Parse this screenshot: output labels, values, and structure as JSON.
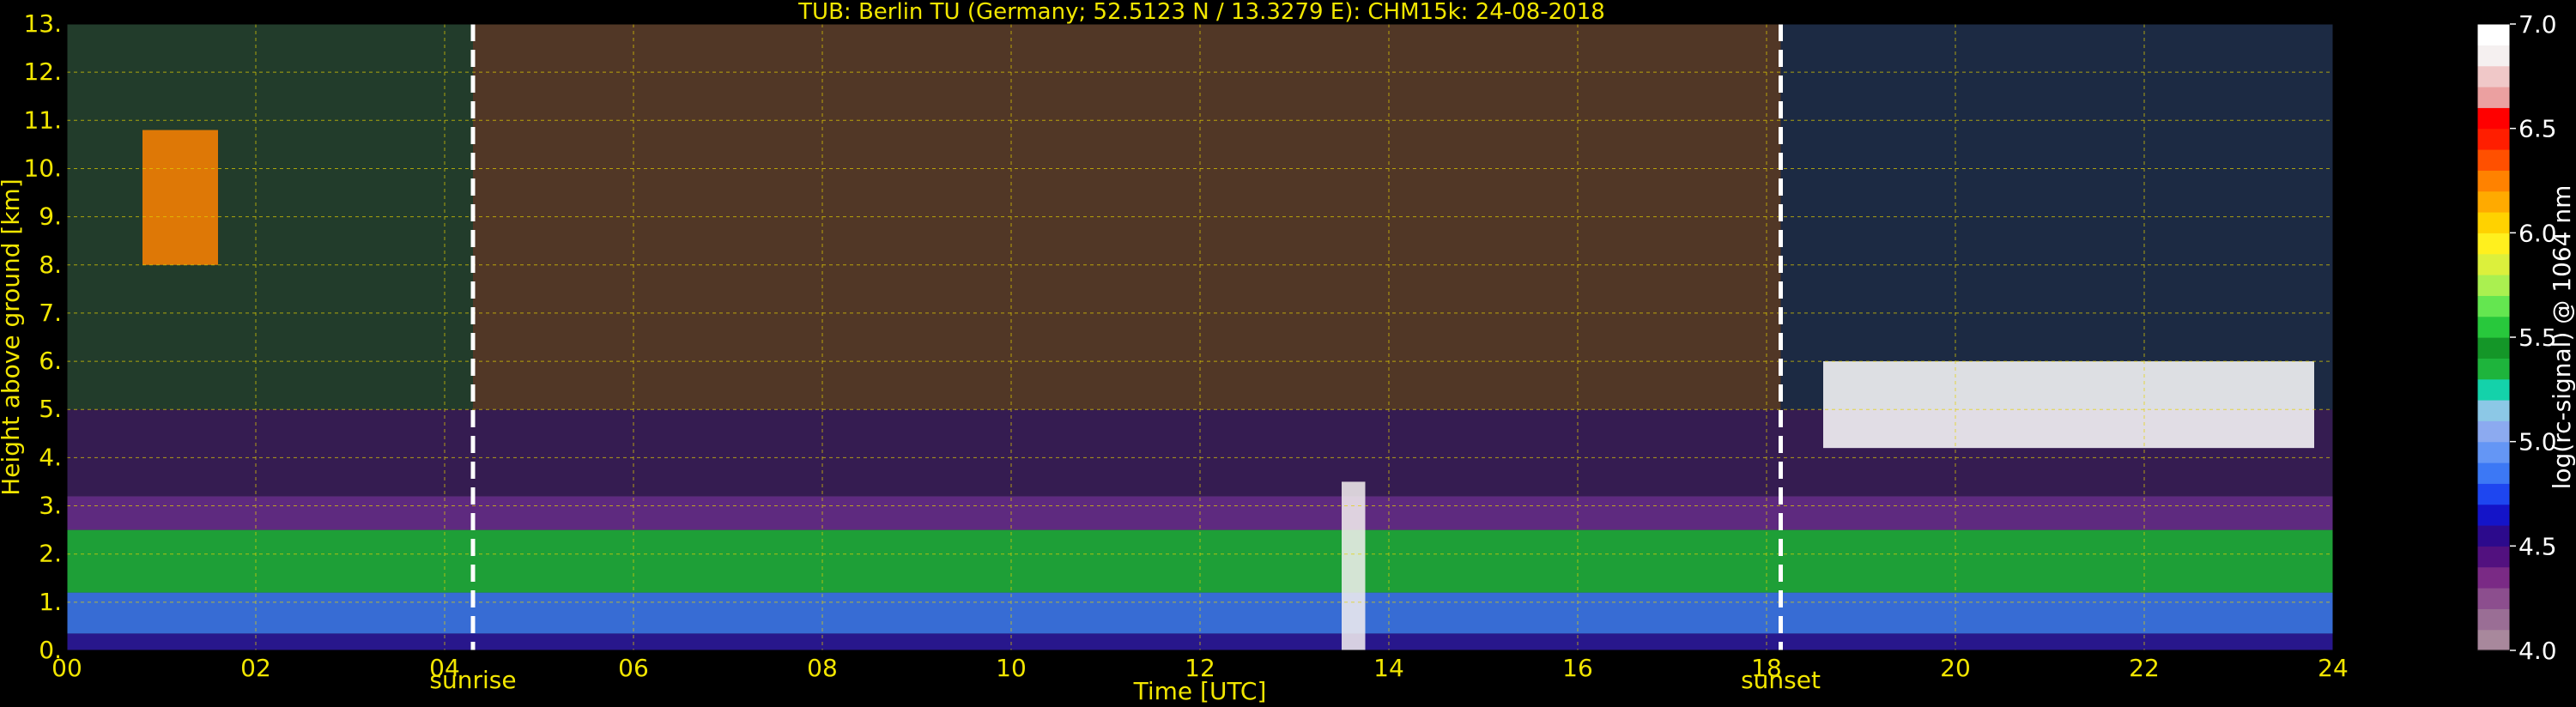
{
  "chart_data": {
    "type": "heatmap",
    "title": "TUB: Berlin TU (Germany; 52.5123 N / 13.3279 E):    CHM15k: 24-08-2018",
    "xlabel": "Time [UTC]",
    "ylabel": "Height above ground [km]",
    "xlim": [
      0,
      24
    ],
    "ylim": [
      0,
      13
    ],
    "x_ticks": [
      0,
      2,
      4,
      6,
      8,
      10,
      12,
      14,
      16,
      18,
      20,
      22,
      24
    ],
    "x_tick_labels": [
      "00",
      "02",
      "04",
      "06",
      "08",
      "10",
      "12",
      "14",
      "16",
      "18",
      "20",
      "22",
      "24"
    ],
    "y_ticks": [
      0,
      1,
      2,
      3,
      4,
      5,
      6,
      7,
      8,
      9,
      10,
      11,
      12,
      13
    ],
    "y_tick_labels": [
      "0.",
      "1.",
      "2.",
      "3.",
      "4.",
      "5.",
      "6.",
      "7.",
      "8.",
      "9.",
      "10.",
      "11.",
      "12.",
      "13."
    ],
    "grid": true,
    "events": [
      {
        "label": "sunrise",
        "time": 4.3
      },
      {
        "label": "sunset",
        "time": 18.15
      }
    ],
    "colorbar": {
      "label": "log(rc-signal) @ 1064 nm",
      "range": [
        4.0,
        7.0
      ],
      "ticks": [
        4.0,
        4.5,
        5.0,
        5.5,
        6.0,
        6.5,
        7.0
      ],
      "tick_labels": [
        "4.0",
        "4.5",
        "5.0",
        "5.5",
        "6.0",
        "6.5",
        "7.0"
      ],
      "colors": [
        "#a8889c",
        "#9a6e95",
        "#8c4e8e",
        "#7a2a85",
        "#52117f",
        "#2c0a8c",
        "#1414c8",
        "#1e46f0",
        "#3c78f5",
        "#6496f5",
        "#8caaf0",
        "#8cc8e6",
        "#14d2aa",
        "#1eb43c",
        "#149628",
        "#28c83c",
        "#64e650",
        "#aaf050",
        "#dcf03c",
        "#fff01e",
        "#ffd200",
        "#ffaa00",
        "#ff8200",
        "#ff5000",
        "#ff1e00",
        "#ff0000",
        "#eba0a0",
        "#f0c8c8",
        "#f5f0f0",
        "#ffffff"
      ]
    }
  }
}
